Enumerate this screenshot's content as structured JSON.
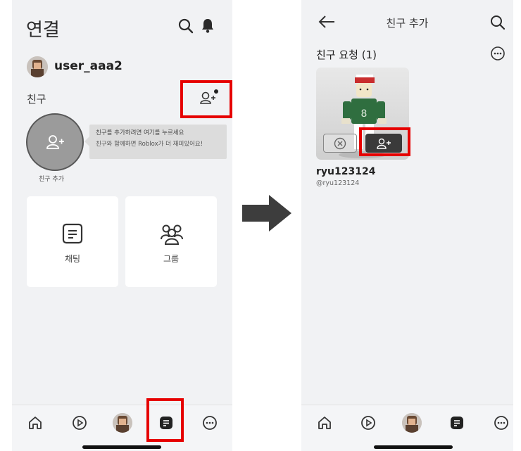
{
  "left_screen": {
    "title": "연결",
    "username": "user_aaa2",
    "friends_label": "친구",
    "tooltip": {
      "line1": "친구를 추가하려면 여기를 누르세요",
      "line2": "친구와 함께하면 Roblox가 더 재미있어요!"
    },
    "add_friend_caption": "친구 추가",
    "cards": [
      {
        "label": "채팅",
        "icon": "chat-icon"
      },
      {
        "label": "그룹",
        "icon": "groups-icon"
      }
    ],
    "nav": [
      "home-icon",
      "play-icon",
      "avatar",
      "chat-icon",
      "more-icon"
    ]
  },
  "right_screen": {
    "title": "친구 추가",
    "section": "친구 요청 (1)",
    "request": {
      "name": "ryu123124",
      "handle": "@ryu123124"
    },
    "nav": [
      "home-icon",
      "play-icon",
      "avatar",
      "chat-icon",
      "more-icon"
    ]
  },
  "colors": {
    "highlight": "#e60000",
    "background": "#f1f2f4",
    "accept_button": "#3a3a3a"
  }
}
